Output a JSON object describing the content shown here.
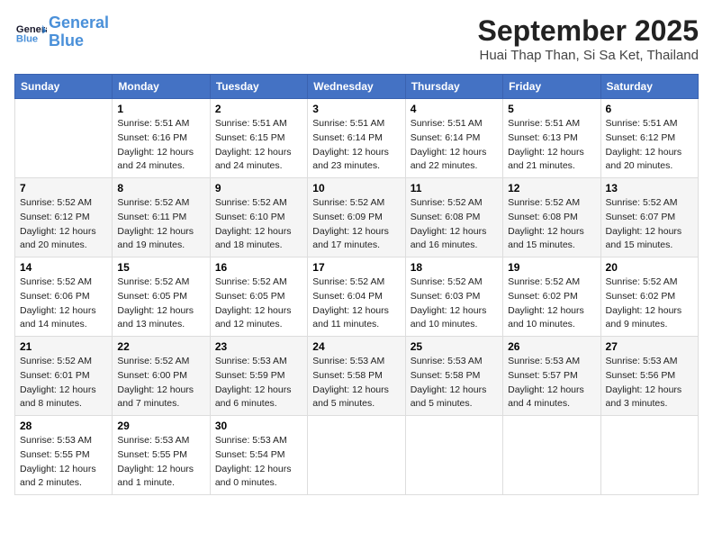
{
  "header": {
    "logo_line1": "General",
    "logo_line2": "Blue",
    "month": "September 2025",
    "location": "Huai Thap Than, Si Sa Ket, Thailand"
  },
  "weekdays": [
    "Sunday",
    "Monday",
    "Tuesday",
    "Wednesday",
    "Thursday",
    "Friday",
    "Saturday"
  ],
  "weeks": [
    [
      {
        "day": "",
        "info": ""
      },
      {
        "day": "1",
        "info": "Sunrise: 5:51 AM\nSunset: 6:16 PM\nDaylight: 12 hours\nand 24 minutes."
      },
      {
        "day": "2",
        "info": "Sunrise: 5:51 AM\nSunset: 6:15 PM\nDaylight: 12 hours\nand 24 minutes."
      },
      {
        "day": "3",
        "info": "Sunrise: 5:51 AM\nSunset: 6:14 PM\nDaylight: 12 hours\nand 23 minutes."
      },
      {
        "day": "4",
        "info": "Sunrise: 5:51 AM\nSunset: 6:14 PM\nDaylight: 12 hours\nand 22 minutes."
      },
      {
        "day": "5",
        "info": "Sunrise: 5:51 AM\nSunset: 6:13 PM\nDaylight: 12 hours\nand 21 minutes."
      },
      {
        "day": "6",
        "info": "Sunrise: 5:51 AM\nSunset: 6:12 PM\nDaylight: 12 hours\nand 20 minutes."
      }
    ],
    [
      {
        "day": "7",
        "info": "Sunrise: 5:52 AM\nSunset: 6:12 PM\nDaylight: 12 hours\nand 20 minutes."
      },
      {
        "day": "8",
        "info": "Sunrise: 5:52 AM\nSunset: 6:11 PM\nDaylight: 12 hours\nand 19 minutes."
      },
      {
        "day": "9",
        "info": "Sunrise: 5:52 AM\nSunset: 6:10 PM\nDaylight: 12 hours\nand 18 minutes."
      },
      {
        "day": "10",
        "info": "Sunrise: 5:52 AM\nSunset: 6:09 PM\nDaylight: 12 hours\nand 17 minutes."
      },
      {
        "day": "11",
        "info": "Sunrise: 5:52 AM\nSunset: 6:08 PM\nDaylight: 12 hours\nand 16 minutes."
      },
      {
        "day": "12",
        "info": "Sunrise: 5:52 AM\nSunset: 6:08 PM\nDaylight: 12 hours\nand 15 minutes."
      },
      {
        "day": "13",
        "info": "Sunrise: 5:52 AM\nSunset: 6:07 PM\nDaylight: 12 hours\nand 15 minutes."
      }
    ],
    [
      {
        "day": "14",
        "info": "Sunrise: 5:52 AM\nSunset: 6:06 PM\nDaylight: 12 hours\nand 14 minutes."
      },
      {
        "day": "15",
        "info": "Sunrise: 5:52 AM\nSunset: 6:05 PM\nDaylight: 12 hours\nand 13 minutes."
      },
      {
        "day": "16",
        "info": "Sunrise: 5:52 AM\nSunset: 6:05 PM\nDaylight: 12 hours\nand 12 minutes."
      },
      {
        "day": "17",
        "info": "Sunrise: 5:52 AM\nSunset: 6:04 PM\nDaylight: 12 hours\nand 11 minutes."
      },
      {
        "day": "18",
        "info": "Sunrise: 5:52 AM\nSunset: 6:03 PM\nDaylight: 12 hours\nand 10 minutes."
      },
      {
        "day": "19",
        "info": "Sunrise: 5:52 AM\nSunset: 6:02 PM\nDaylight: 12 hours\nand 10 minutes."
      },
      {
        "day": "20",
        "info": "Sunrise: 5:52 AM\nSunset: 6:02 PM\nDaylight: 12 hours\nand 9 minutes."
      }
    ],
    [
      {
        "day": "21",
        "info": "Sunrise: 5:52 AM\nSunset: 6:01 PM\nDaylight: 12 hours\nand 8 minutes."
      },
      {
        "day": "22",
        "info": "Sunrise: 5:52 AM\nSunset: 6:00 PM\nDaylight: 12 hours\nand 7 minutes."
      },
      {
        "day": "23",
        "info": "Sunrise: 5:53 AM\nSunset: 5:59 PM\nDaylight: 12 hours\nand 6 minutes."
      },
      {
        "day": "24",
        "info": "Sunrise: 5:53 AM\nSunset: 5:58 PM\nDaylight: 12 hours\nand 5 minutes."
      },
      {
        "day": "25",
        "info": "Sunrise: 5:53 AM\nSunset: 5:58 PM\nDaylight: 12 hours\nand 5 minutes."
      },
      {
        "day": "26",
        "info": "Sunrise: 5:53 AM\nSunset: 5:57 PM\nDaylight: 12 hours\nand 4 minutes."
      },
      {
        "day": "27",
        "info": "Sunrise: 5:53 AM\nSunset: 5:56 PM\nDaylight: 12 hours\nand 3 minutes."
      }
    ],
    [
      {
        "day": "28",
        "info": "Sunrise: 5:53 AM\nSunset: 5:55 PM\nDaylight: 12 hours\nand 2 minutes."
      },
      {
        "day": "29",
        "info": "Sunrise: 5:53 AM\nSunset: 5:55 PM\nDaylight: 12 hours\nand 1 minute."
      },
      {
        "day": "30",
        "info": "Sunrise: 5:53 AM\nSunset: 5:54 PM\nDaylight: 12 hours\nand 0 minutes."
      },
      {
        "day": "",
        "info": ""
      },
      {
        "day": "",
        "info": ""
      },
      {
        "day": "",
        "info": ""
      },
      {
        "day": "",
        "info": ""
      }
    ]
  ]
}
